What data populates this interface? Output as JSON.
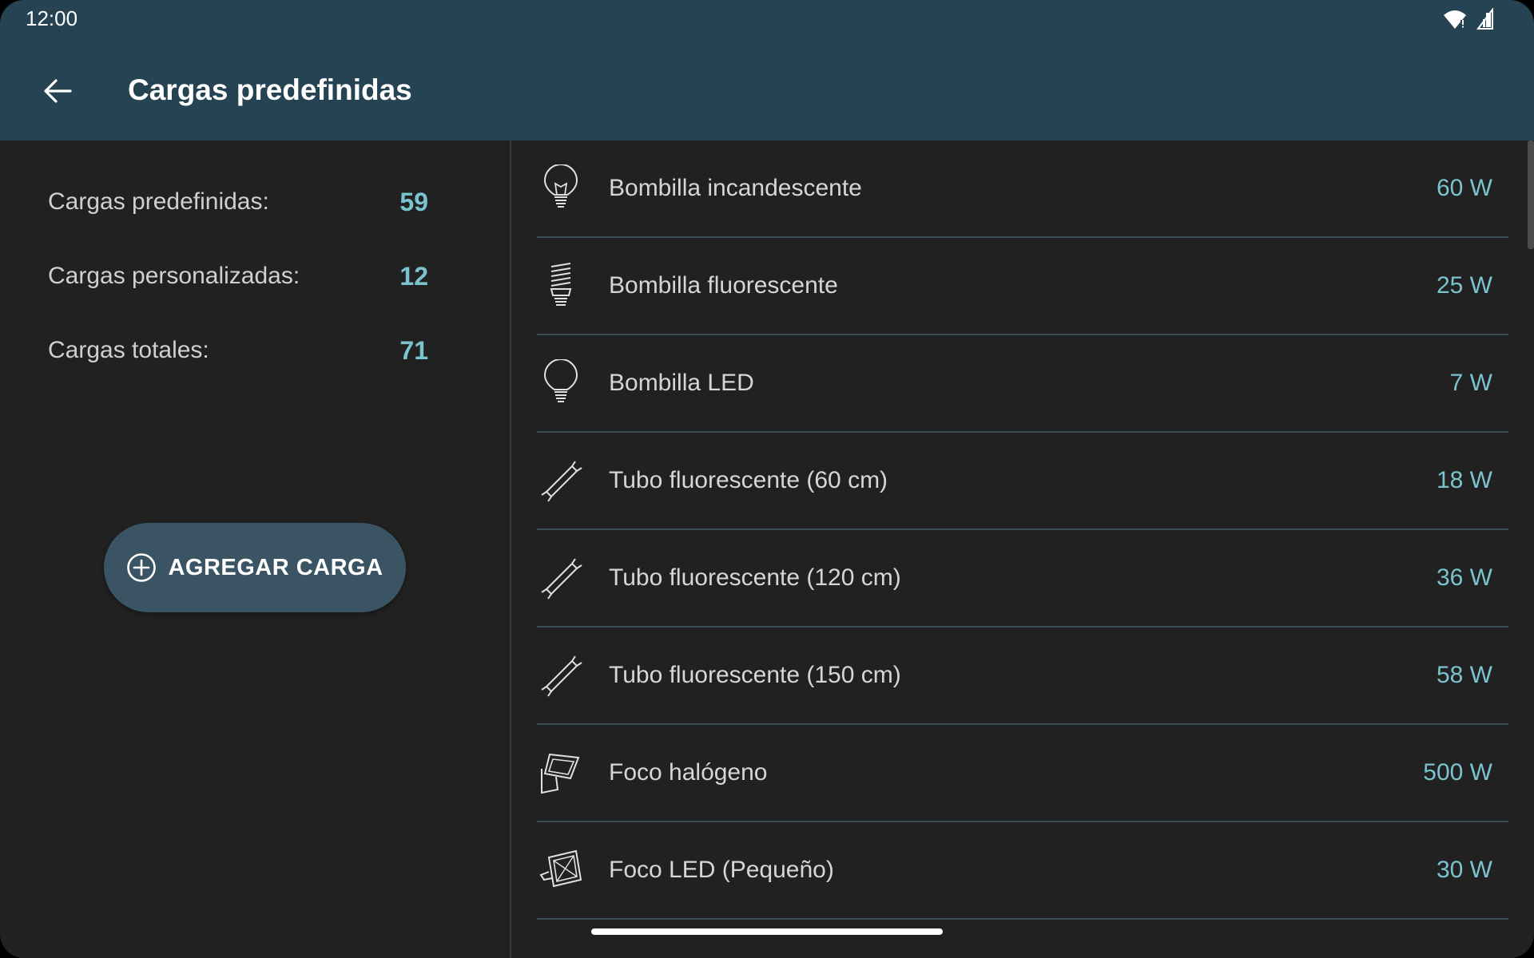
{
  "status_bar": {
    "time": "12:00",
    "icons": [
      "wifi-icon",
      "signal-icon"
    ]
  },
  "app_bar": {
    "title": "Cargas predefinidas",
    "back_icon": "arrow-back-icon"
  },
  "summary": [
    {
      "label": "Cargas predefinidas:",
      "value": "59"
    },
    {
      "label": "Cargas personalizadas:",
      "value": "12"
    },
    {
      "label": "Cargas totales:",
      "value": "71"
    }
  ],
  "add_button": {
    "label": "AGREGAR CARGA",
    "icon": "add-circle-icon"
  },
  "loads": [
    {
      "name": "Bombilla incandescente",
      "power": "60 W",
      "icon": "incandescent-bulb-icon"
    },
    {
      "name": "Bombilla fluorescente",
      "power": "25 W",
      "icon": "fluorescent-bulb-icon"
    },
    {
      "name": "Bombilla LED",
      "power": "7 W",
      "icon": "led-bulb-icon"
    },
    {
      "name": "Tubo fluorescente (60 cm)",
      "power": "18 W",
      "icon": "fluorescent-tube-icon"
    },
    {
      "name": "Tubo fluorescente (120 cm)",
      "power": "36 W",
      "icon": "fluorescent-tube-icon"
    },
    {
      "name": "Tubo fluorescente (150 cm)",
      "power": "58 W",
      "icon": "fluorescent-tube-icon"
    },
    {
      "name": "Foco halógeno",
      "power": "500 W",
      "icon": "halogen-floodlight-icon"
    },
    {
      "name": "Foco LED (Pequeño)",
      "power": "30 W",
      "icon": "led-floodlight-icon"
    }
  ],
  "colors": {
    "app_bar": "#254353",
    "background": "#212121",
    "accent": "#7ac3cf",
    "button": "#3a5464",
    "divider": "#3e4c54"
  }
}
